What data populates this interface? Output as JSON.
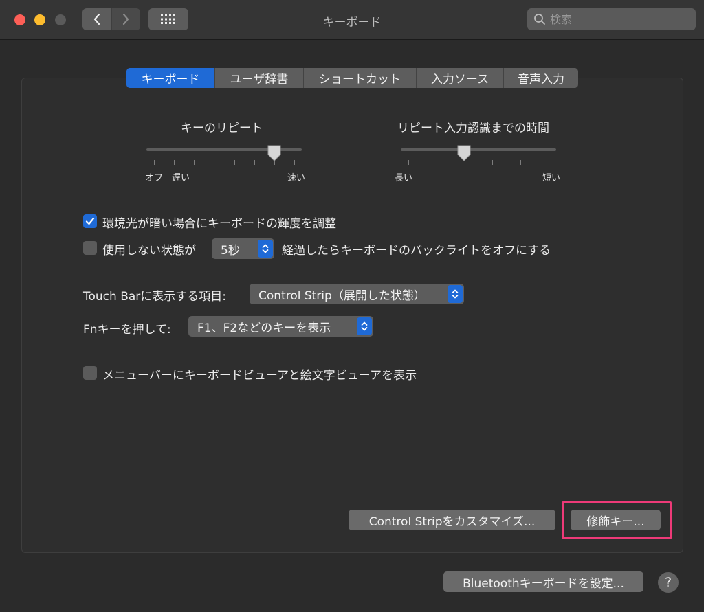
{
  "window": {
    "title": "キーボード"
  },
  "search": {
    "placeholder": "検索"
  },
  "tabs": [
    {
      "label": "キーボード",
      "active": true
    },
    {
      "label": "ユーザ辞書",
      "active": false
    },
    {
      "label": "ショートカット",
      "active": false
    },
    {
      "label": "入力ソース",
      "active": false
    },
    {
      "label": "音声入力",
      "active": false
    }
  ],
  "key_repeat": {
    "title": "キーのリピート",
    "label_off": "オフ",
    "label_slow": "遅い",
    "label_fast": "速い",
    "tick_count": 8,
    "selected_step": 7
  },
  "repeat_delay": {
    "title": "リピート入力認識までの時間",
    "label_long": "長い",
    "label_short": "短い",
    "tick_count": 6,
    "selected_step": 3
  },
  "options": {
    "ambient_light": {
      "label": "環境光が暗い場合にキーボードの輝度を調整",
      "checked": true
    },
    "idle_off": {
      "label_before": "使用しない状態が",
      "duration": "5秒",
      "label_after": "経過したらキーボードのバックライトをオフにする",
      "checked": false
    },
    "touchbar": {
      "label": "Touch Barに表示する項目:",
      "value": "Control Strip（展開した状態）"
    },
    "fn_key": {
      "label": "Fnキーを押して:",
      "value": "F1、F2などのキーを表示"
    },
    "menubar_viewer": {
      "label": "メニューバーにキーボードビューアと絵文字ビューアを表示",
      "checked": false
    }
  },
  "buttons": {
    "customize_control_strip": "Control Stripをカスタマイズ...",
    "modifier_keys": "修飾キー...",
    "bluetooth_setup": "Bluetoothキーボードを設定...",
    "help": "?"
  },
  "colors": {
    "accent": "#1f6ad6",
    "highlight": "#ee3a78",
    "close": "#fd5f57",
    "minimize": "#fdbc2e"
  }
}
